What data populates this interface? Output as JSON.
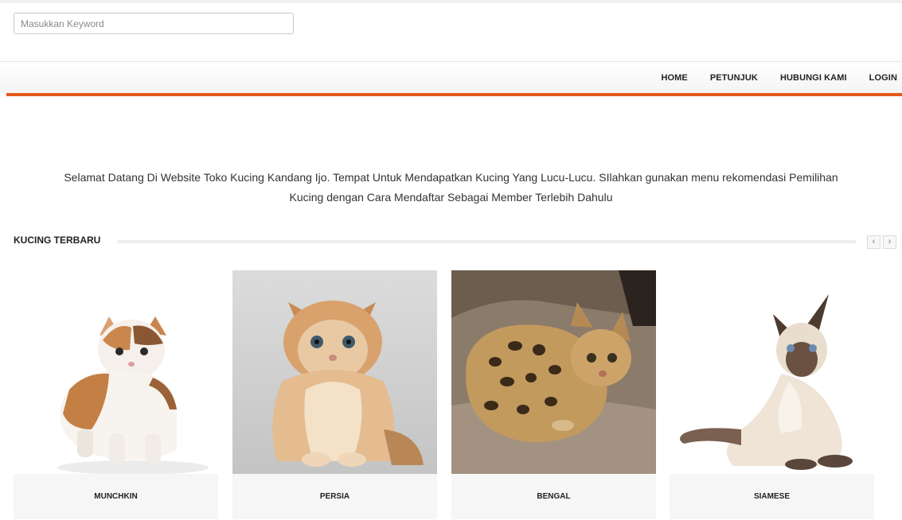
{
  "search": {
    "placeholder": "Masukkan Keyword"
  },
  "nav": {
    "items": [
      "HOME",
      "PETUNJUK",
      "HUBUNGI KAMI",
      "LOGIN"
    ],
    "accent_color": "#e35a1b"
  },
  "welcome": {
    "line1": "Selamat Datang Di Website Toko Kucing Kandang Ijo. Tempat Untuk Mendapatkan Kucing Yang Lucu-Lucu. SIlahkan gunakan menu rekomendasi Pemilihan",
    "line2": "Kucing dengan Cara Mendaftar Sebagai Member Terlebih Dahulu"
  },
  "section": {
    "title": "KUCING TERBARU",
    "prev_icon": "chevron-left-icon",
    "next_icon": "chevron-right-icon",
    "prev_glyph": "‹",
    "next_glyph": "›"
  },
  "cats": [
    {
      "name": "MUNCHKIN"
    },
    {
      "name": "PERSIA"
    },
    {
      "name": "BENGAL"
    },
    {
      "name": "SIAMESE"
    }
  ]
}
